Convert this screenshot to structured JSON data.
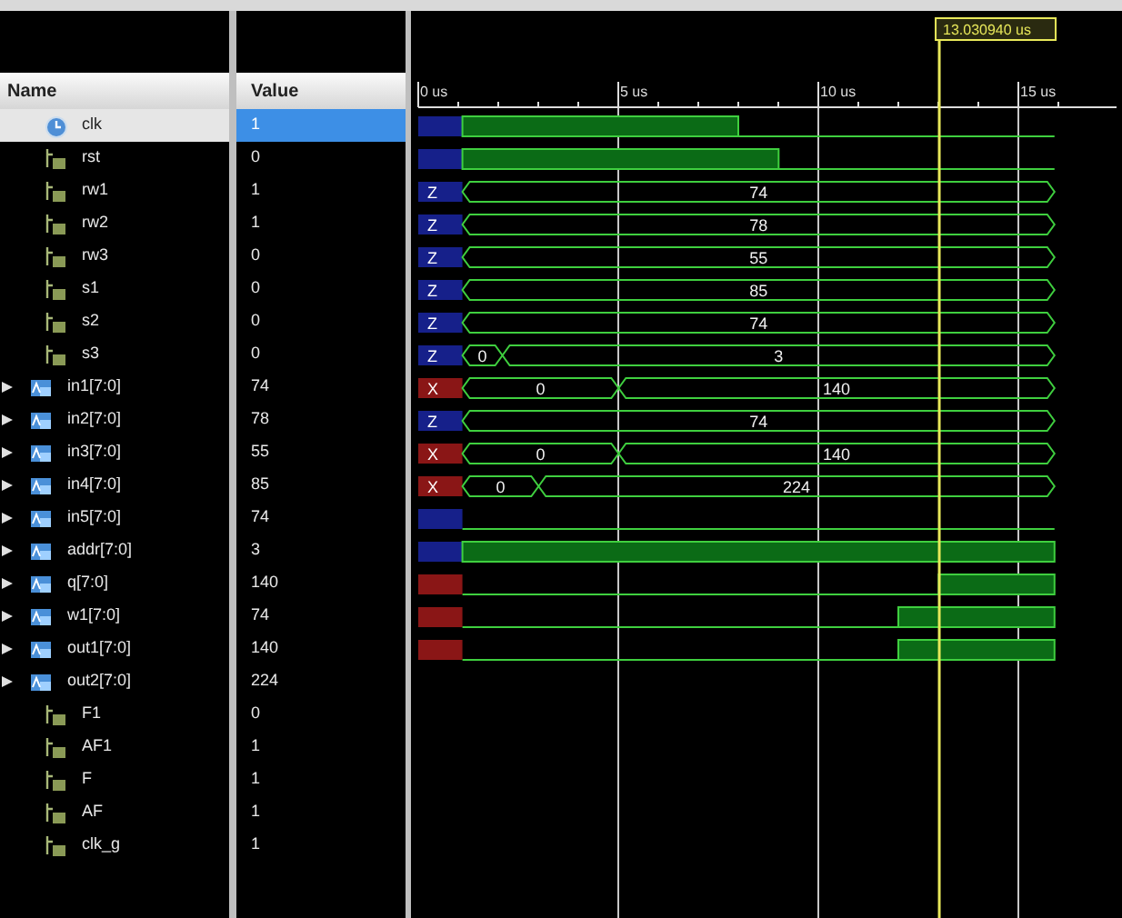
{
  "columns": {
    "name": "Name",
    "value": "Value"
  },
  "signals": [
    {
      "name": "clk",
      "value": "1",
      "kind": "clock",
      "selected": true
    },
    {
      "name": "rst",
      "value": "0",
      "kind": "bit",
      "selected": false
    },
    {
      "name": "rw1",
      "value": "1",
      "kind": "bit",
      "selected": false
    },
    {
      "name": "rw2",
      "value": "1",
      "kind": "bit",
      "selected": false
    },
    {
      "name": "rw3",
      "value": "0",
      "kind": "bit",
      "selected": false
    },
    {
      "name": "s1",
      "value": "0",
      "kind": "bit",
      "selected": false
    },
    {
      "name": "s2",
      "value": "0",
      "kind": "bit",
      "selected": false
    },
    {
      "name": "s3",
      "value": "0",
      "kind": "bit",
      "selected": false
    },
    {
      "name": "in1[7:0]",
      "value": "74",
      "kind": "bus",
      "selected": false
    },
    {
      "name": "in2[7:0]",
      "value": "78",
      "kind": "bus",
      "selected": false
    },
    {
      "name": "in3[7:0]",
      "value": "55",
      "kind": "bus",
      "selected": false
    },
    {
      "name": "in4[7:0]",
      "value": "85",
      "kind": "bus",
      "selected": false
    },
    {
      "name": "in5[7:0]",
      "value": "74",
      "kind": "bus",
      "selected": false
    },
    {
      "name": "addr[7:0]",
      "value": "3",
      "kind": "bus",
      "selected": false
    },
    {
      "name": "q[7:0]",
      "value": "140",
      "kind": "bus",
      "selected": false
    },
    {
      "name": "w1[7:0]",
      "value": "74",
      "kind": "bus",
      "selected": false
    },
    {
      "name": "out1[7:0]",
      "value": "140",
      "kind": "bus",
      "selected": false
    },
    {
      "name": "out2[7:0]",
      "value": "224",
      "kind": "bus",
      "selected": false
    },
    {
      "name": "F1",
      "value": "0",
      "kind": "bit",
      "selected": false
    },
    {
      "name": "AF1",
      "value": "1",
      "kind": "bit",
      "selected": false
    },
    {
      "name": "F",
      "value": "1",
      "kind": "bit",
      "selected": false
    },
    {
      "name": "AF",
      "value": "1",
      "kind": "bit",
      "selected": false
    },
    {
      "name": "clk_g",
      "value": "1",
      "kind": "bit",
      "selected": false
    }
  ],
  "waveform": {
    "time_labels": [
      "0 us",
      "5 us",
      "10 us",
      "15 us"
    ],
    "cursor": {
      "label": "13.030940 us"
    },
    "rows": [
      {
        "segments": [
          {
            "kind": "z"
          },
          {
            "kind": "high"
          },
          {
            "kind": "low"
          }
        ]
      },
      {
        "segments": [
          {
            "kind": "z"
          },
          {
            "kind": "high"
          },
          {
            "kind": "low"
          }
        ]
      },
      {
        "segments": [
          {
            "kind": "z",
            "label": "Z"
          },
          {
            "kind": "bus",
            "label": "74"
          }
        ]
      },
      {
        "segments": [
          {
            "kind": "z",
            "label": "Z"
          },
          {
            "kind": "bus",
            "label": "78"
          }
        ]
      },
      {
        "segments": [
          {
            "kind": "z",
            "label": "Z"
          },
          {
            "kind": "bus",
            "label": "55"
          }
        ]
      },
      {
        "segments": [
          {
            "kind": "z",
            "label": "Z"
          },
          {
            "kind": "bus",
            "label": "85"
          }
        ]
      },
      {
        "segments": [
          {
            "kind": "z",
            "label": "Z"
          },
          {
            "kind": "bus",
            "label": "74"
          }
        ]
      },
      {
        "segments": [
          {
            "kind": "z",
            "label": "Z"
          },
          {
            "kind": "bus",
            "label": "0"
          },
          {
            "kind": "bus",
            "label": "3"
          }
        ]
      },
      {
        "segments": [
          {
            "kind": "x",
            "label": "X"
          },
          {
            "kind": "bus",
            "label": "0"
          },
          {
            "kind": "bus",
            "label": "140"
          }
        ]
      },
      {
        "segments": [
          {
            "kind": "z",
            "label": "Z"
          },
          {
            "kind": "bus",
            "label": "74"
          }
        ]
      },
      {
        "segments": [
          {
            "kind": "x",
            "label": "X"
          },
          {
            "kind": "bus",
            "label": "0"
          },
          {
            "kind": "bus",
            "label": "140"
          }
        ]
      },
      {
        "segments": [
          {
            "kind": "x",
            "label": "X"
          },
          {
            "kind": "bus",
            "label": "0"
          },
          {
            "kind": "bus",
            "label": "224"
          }
        ]
      },
      {
        "segments": [
          {
            "kind": "z"
          },
          {
            "kind": "low"
          }
        ]
      },
      {
        "segments": [
          {
            "kind": "z"
          },
          {
            "kind": "high"
          }
        ]
      },
      {
        "segments": [
          {
            "kind": "x"
          },
          {
            "kind": "low"
          },
          {
            "kind": "high"
          }
        ]
      },
      {
        "segments": [
          {
            "kind": "x"
          },
          {
            "kind": "low"
          },
          {
            "kind": "high"
          }
        ]
      },
      {
        "segments": [
          {
            "kind": "x"
          },
          {
            "kind": "low"
          },
          {
            "kind": "high"
          }
        ]
      }
    ]
  }
}
